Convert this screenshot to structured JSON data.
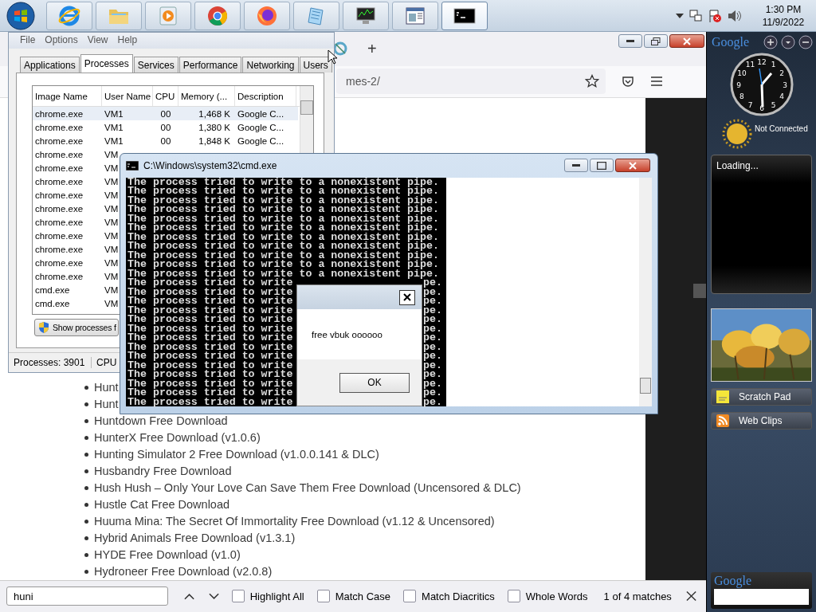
{
  "taskbar": {
    "apps": [
      {
        "kind": "ie",
        "selected": false
      },
      {
        "kind": "folder",
        "selected": false
      },
      {
        "kind": "media",
        "selected": false
      },
      {
        "kind": "chrome",
        "selected": false
      },
      {
        "kind": "firefox",
        "selected": false
      },
      {
        "kind": "notepad",
        "selected": false
      },
      {
        "kind": "monitor",
        "selected": false
      },
      {
        "kind": "window",
        "selected": false
      },
      {
        "kind": "cmd",
        "selected": true
      }
    ],
    "time": "1:30 PM",
    "date": "11/9/2022"
  },
  "browser": {
    "new_tab": "+",
    "url": "mes-2/",
    "list": [
      "Hunt",
      "Hunt",
      "Huntdown Free Download",
      "HunterX Free Download (v1.0.6)",
      "Hunting Simulator 2 Free Download (v1.0.0.141 & DLC)",
      "Husbandry Free Download",
      "Hush Hush – Only Your Love Can Save Them Free Download (Uncensored & DLC)",
      "Hustle Cat Free Download",
      "Huuma Mina: The Secret Of Immortality Free Download (v1.12 & Uncensored)",
      "Hybrid Animals Free Download (v1.3.1)",
      "HYDE Free Download (v1.0)",
      "Hydroneer Free Download (v2.0.8)"
    ],
    "find_bar": {
      "value": "huni",
      "options": [
        {
          "label": "Highlight All",
          "checked": false
        },
        {
          "label": "Match Case",
          "checked": false
        },
        {
          "label": "Match Diacritics",
          "checked": false
        },
        {
          "label": "Whole Words",
          "checked": false
        }
      ],
      "result": "1 of 4 matches"
    }
  },
  "task_manager": {
    "menu": [
      "File",
      "Options",
      "View",
      "Help"
    ],
    "tabs": [
      {
        "label": "Applications",
        "selected": false
      },
      {
        "label": "Processes",
        "selected": true
      },
      {
        "label": "Services",
        "selected": false
      },
      {
        "label": "Performance",
        "selected": false
      },
      {
        "label": "Networking",
        "selected": false
      },
      {
        "label": "Users",
        "selected": false
      }
    ],
    "columns": [
      "Image Name",
      "User Name",
      "CPU",
      "Memory (...",
      "Description"
    ],
    "rows": [
      {
        "cells": [
          "chrome.exe",
          "VM1",
          "00",
          "1,468 K",
          "Google C..."
        ],
        "selected": true
      },
      {
        "cells": [
          "chrome.exe",
          "VM1",
          "00",
          "1,380 K",
          "Google C..."
        ],
        "selected": false
      },
      {
        "cells": [
          "chrome.exe",
          "VM1",
          "00",
          "1,848 K",
          "Google C..."
        ],
        "selected": false
      },
      {
        "cells": [
          "chrome.exe",
          "VM"
        ],
        "selected": false
      },
      {
        "cells": [
          "chrome.exe",
          "VM"
        ],
        "selected": false
      },
      {
        "cells": [
          "chrome.exe",
          "VM"
        ],
        "selected": false
      },
      {
        "cells": [
          "chrome.exe",
          "VM"
        ],
        "selected": false
      },
      {
        "cells": [
          "chrome.exe",
          "VM"
        ],
        "selected": false
      },
      {
        "cells": [
          "chrome.exe",
          "VM"
        ],
        "selected": false
      },
      {
        "cells": [
          "chrome.exe",
          "VM"
        ],
        "selected": false
      },
      {
        "cells": [
          "chrome.exe",
          "VM"
        ],
        "selected": false
      },
      {
        "cells": [
          "chrome.exe",
          "VM"
        ],
        "selected": false
      },
      {
        "cells": [
          "chrome.exe",
          "VM"
        ],
        "selected": false
      },
      {
        "cells": [
          "cmd.exe",
          "VM"
        ],
        "selected": false
      },
      {
        "cells": [
          "cmd.exe",
          "VM"
        ],
        "selected": false
      }
    ],
    "button": "Show processes f",
    "status": [
      "Processes: 3901",
      "CPU"
    ]
  },
  "cmd": {
    "title": "C:\\Windows\\system32\\cmd.exe",
    "lines": [
      {
        "text": "The process tried to write to a nonexistent pipe."
      },
      {
        "text": "The process tried to write to a nonexistent pipe."
      },
      {
        "text": "The process tried to write to a nonexistent pipe."
      },
      {
        "text": "The process tried to write to a nonexistent pipe."
      },
      {
        "text": "The process tried to write to a nonexistent pipe."
      },
      {
        "text": "The process tried to write to a nonexistent pipe."
      },
      {
        "text": "The process tried to write to a nonexistent pipe."
      },
      {
        "text": "The process tried to write to a nonexistent pipe."
      },
      {
        "text": "The process tried to write to a nonexistent pipe."
      },
      {
        "text": "The process tried to write to a nonexistent pipe."
      },
      {
        "text": "The process tried to write to a nonexistent pipe."
      },
      {
        "text": "The process tried to write",
        "tail": "pe."
      },
      {
        "text": "The process tried to write",
        "tail": "pe."
      },
      {
        "text": "The process tried to write",
        "tail": "pe."
      },
      {
        "text": "The process tried to write",
        "tail": "pe."
      },
      {
        "text": "The process tried to write",
        "tail": "pe."
      },
      {
        "text": "The process tried to write",
        "tail": "pe."
      },
      {
        "text": "The process tried to write",
        "tail": "pe."
      },
      {
        "text": "The process tried to write",
        "tail": "pe."
      },
      {
        "text": "The process tried to write",
        "tail": "pe."
      },
      {
        "text": "The process tried to write",
        "tail": "pe."
      },
      {
        "text": "The process tried to write",
        "tail": "pe."
      },
      {
        "text": "The process tried to write",
        "tail": "pe."
      },
      {
        "text": "The process tried to write",
        "tail": "pe."
      },
      {
        "text": "The process tried to write",
        "tail": "pe."
      }
    ]
  },
  "dialog": {
    "message": "free vbuk oooooo",
    "button": "OK"
  },
  "sidebar": {
    "logo": "Google",
    "clock_numbers": [
      "12",
      "11",
      "1",
      "10",
      "2",
      "9",
      "3",
      "8",
      "4",
      "7",
      "5",
      "6"
    ],
    "weather": "Not Connected",
    "loading": "Loading...",
    "buttons": [
      {
        "label": "Scratch Pad",
        "kind": "note"
      },
      {
        "label": "Web Clips",
        "kind": "rss"
      }
    ],
    "search_logo": "Google"
  }
}
